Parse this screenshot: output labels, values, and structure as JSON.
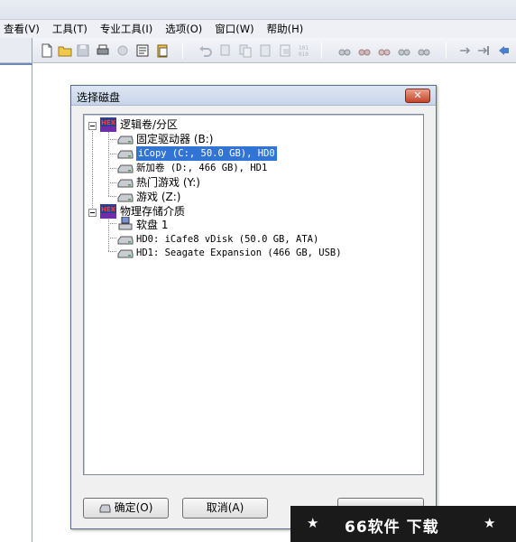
{
  "menubar": {
    "items": [
      "查看(V)",
      "工具(T)",
      "专业工具(I)",
      "选项(O)",
      "窗口(W)",
      "帮助(H)"
    ]
  },
  "toolbar": {
    "icons": [
      "new-file-icon",
      "open-folder-icon",
      "save-icon",
      "print-icon",
      "properties-icon",
      "clipboard-icon",
      "undo-icon",
      "copy-icon",
      "paste-icon",
      "binary-icon",
      "find-icon",
      "find-next-icon",
      "goto-icon",
      "arrow-right-icon",
      "bookmark-icon"
    ]
  },
  "dialog": {
    "title": "选择磁盘",
    "close_label": "✕",
    "tree": {
      "logical": {
        "label": "逻辑卷/分区",
        "items": [
          "固定驱动器 (B:)",
          "iCopy (C:, 50.0 GB), HD0",
          "新加卷 (D:, 466 GB), HD1",
          "热门游戏 (Y:)",
          "游戏 (Z:)"
        ],
        "selected_index": 1
      },
      "physical": {
        "label": "物理存储介质",
        "items": [
          "软盘 1",
          "HD0: iCafe8 vDisk (50.0 GB, ATA)",
          "HD1: Seagate Expansion (466 GB, USB)"
        ]
      }
    },
    "ok_label": "确定(O)",
    "cancel_label": "取消(A)"
  },
  "watermark": {
    "text": "66软件 下载",
    "star": "★"
  },
  "colors": {
    "selection": "#3174d4",
    "close_button": "#c8432a",
    "titlebar": "#c7d5ea"
  }
}
